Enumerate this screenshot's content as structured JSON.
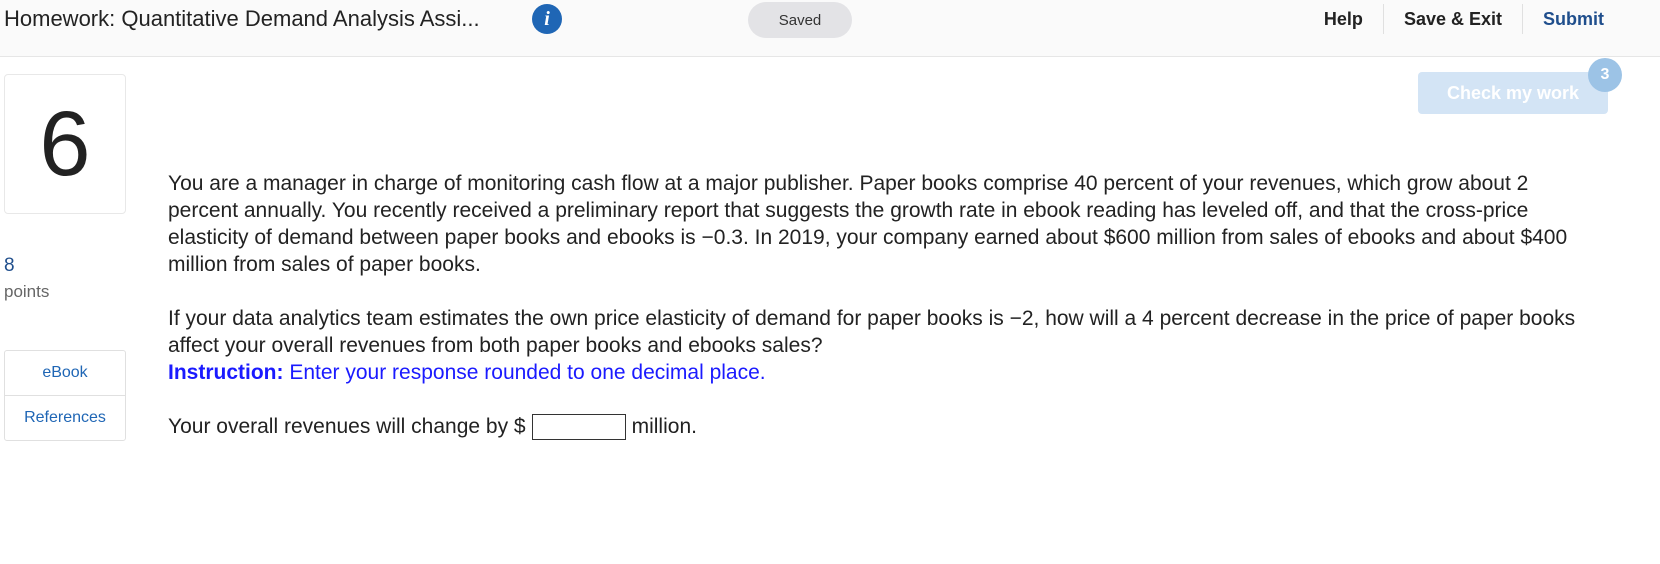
{
  "header": {
    "title": "Homework: Quantitative Demand Analysis Assi...",
    "info_icon": "info-icon",
    "saved_label": "Saved",
    "actions": {
      "help": "Help",
      "save_exit": "Save & Exit",
      "submit": "Submit"
    }
  },
  "question": {
    "number": "6",
    "points_value": "8",
    "points_label": "points",
    "side_links": [
      "eBook",
      "References"
    ]
  },
  "check_my_work": {
    "label": "Check my work",
    "badge": "3"
  },
  "content": {
    "paragraph1": "You are a manager in charge of monitoring cash flow at a major publisher. Paper books comprise 40 percent of your revenues, which grow about 2 percent annually. You recently received a preliminary report that suggests the growth rate in ebook reading has leveled off, and that the cross-price elasticity of demand between paper books and ebooks is −0.3. In 2019, your company earned about $600 million from sales of ebooks and about $400 million from sales of paper books.",
    "paragraph2": "If your data analytics team estimates the own price elasticity of demand for paper books is −2, how will a 4 percent decrease in the price of paper books affect your overall revenues from both paper books and ebooks sales?",
    "instruction_label": "Instruction:",
    "instruction_text": " Enter your response rounded to one decimal place.",
    "answer_prefix": "Your overall revenues will change by $",
    "answer_value": "",
    "answer_suffix": "million."
  },
  "colors": {
    "accent": "#1f66b5",
    "instruction": "#1a1aff",
    "check_button": "#d3e4f5"
  }
}
